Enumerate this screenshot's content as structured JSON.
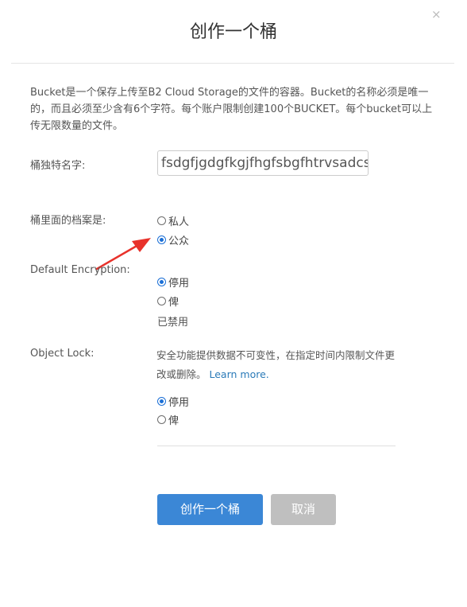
{
  "dialog": {
    "title": "创作一个桶",
    "close_icon": "×",
    "intro_text": "Bucket是一个保存上传至B2 Cloud Storage的文件的容器。Bucket的名称必须是唯一的，而且必须至少含有6个字符。每个账户限制创建100个BUCKET。每个bucket可以上传无限数量的文件。"
  },
  "name_field": {
    "label": "桶独特名字:",
    "value": "fsdgfjgdgfkgjfhgfsbgfhtrvsadcsdc"
  },
  "visibility": {
    "label": "桶里面的档案是:",
    "options": [
      {
        "label": "私人",
        "checked": false
      },
      {
        "label": "公众",
        "checked": true
      }
    ]
  },
  "encryption": {
    "label": "Default Encryption:",
    "options": [
      {
        "label": "停用",
        "checked": true
      },
      {
        "label": "俾",
        "checked": false
      }
    ],
    "status_text": "已禁用"
  },
  "object_lock": {
    "label": "Object Lock:",
    "description": "安全功能提供数据不可变性，在指定时间内限制文件更改或删除。",
    "learn_more": "Learn more.",
    "options": [
      {
        "label": "停用",
        "checked": true
      },
      {
        "label": "俾",
        "checked": false
      }
    ]
  },
  "buttons": {
    "create_label": "创作一个桶",
    "cancel_label": "取消"
  },
  "annotation": {
    "arrow_color": "#e8322b"
  },
  "colors": {
    "primary": "#3b87d6",
    "cancel": "#bfbfbf",
    "link": "#2a7ab8"
  }
}
